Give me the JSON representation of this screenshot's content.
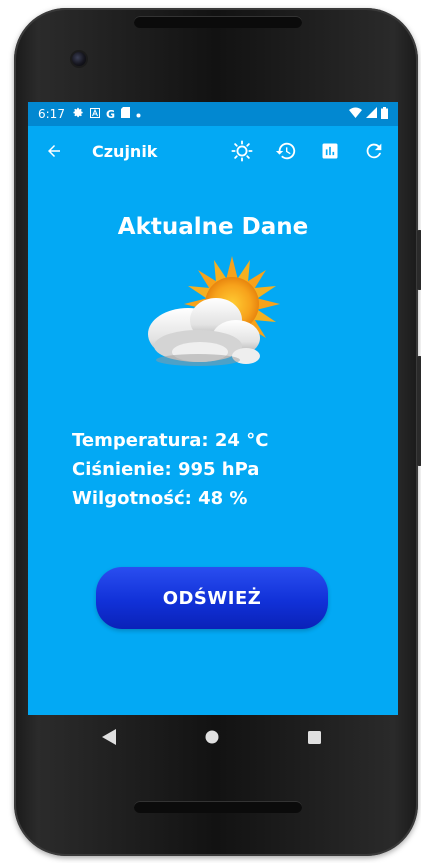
{
  "status_bar": {
    "time": "6:17",
    "icons": [
      "gear-icon",
      "a-icon",
      "google-icon",
      "sd-card-icon",
      "dot-icon",
      "wifi-icon",
      "signal-icon",
      "battery-icon"
    ],
    "google_letter": "G"
  },
  "app_bar": {
    "title": "Czujnik",
    "icons": [
      "back-arrow-icon",
      "brightness-icon",
      "history-icon",
      "bar-chart-icon",
      "refresh-icon"
    ]
  },
  "main": {
    "heading": "Aktualne Dane",
    "weather_icon": "partly-cloudy-icon",
    "temperature": "Temperatura: 24 °C",
    "pressure": "Ciśnienie: 995 hPa",
    "humidity": "Wilgotność: 48 %",
    "refresh_button": "ODŚWIEŻ"
  },
  "nav_bar": {
    "icons": [
      "back-triangle-icon",
      "home-circle-icon",
      "recents-square-icon"
    ]
  },
  "colors": {
    "background": "#03a9f4",
    "status_bar": "#0288d1",
    "button": "#1131d8",
    "text": "#ffffff"
  }
}
